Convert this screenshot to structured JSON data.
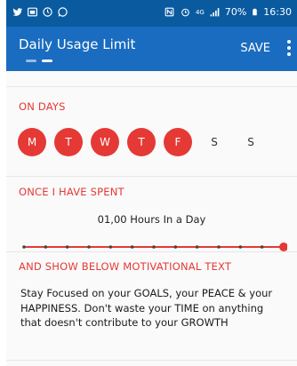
{
  "status_bar": {
    "left_icons": [
      "twitter-icon",
      "gallery-icon",
      "sync-icon",
      "whatsapp-icon"
    ],
    "network_label": "4G",
    "battery": "70%",
    "time": "16:30"
  },
  "app_bar": {
    "title": "Daily Usage Limit",
    "save_label": "SAVE",
    "background": "#1a6cc0",
    "status_bar_background": "#0a5aa0"
  },
  "on_days": {
    "title": "ON DAYS",
    "days": [
      {
        "label": "M",
        "selected": true
      },
      {
        "label": "T",
        "selected": true
      },
      {
        "label": "W",
        "selected": true
      },
      {
        "label": "T",
        "selected": true
      },
      {
        "label": "F",
        "selected": true
      },
      {
        "label": "S",
        "selected": false
      },
      {
        "label": "S",
        "selected": false
      }
    ]
  },
  "spent": {
    "title": "ONCE I HAVE SPENT",
    "hours_text": "01,00 Hours In a Day",
    "slider_steps": 13,
    "slider_value_step": 12
  },
  "motivation": {
    "title": "AND SHOW BELOW MOTIVATIONAL TEXT",
    "text": "Stay Focused on your GOALS, your PEACE & your HAPPINESS. Don't waste your TIME on anything that doesn't contribute to your GROWTH"
  },
  "accent_color": "#e53935"
}
